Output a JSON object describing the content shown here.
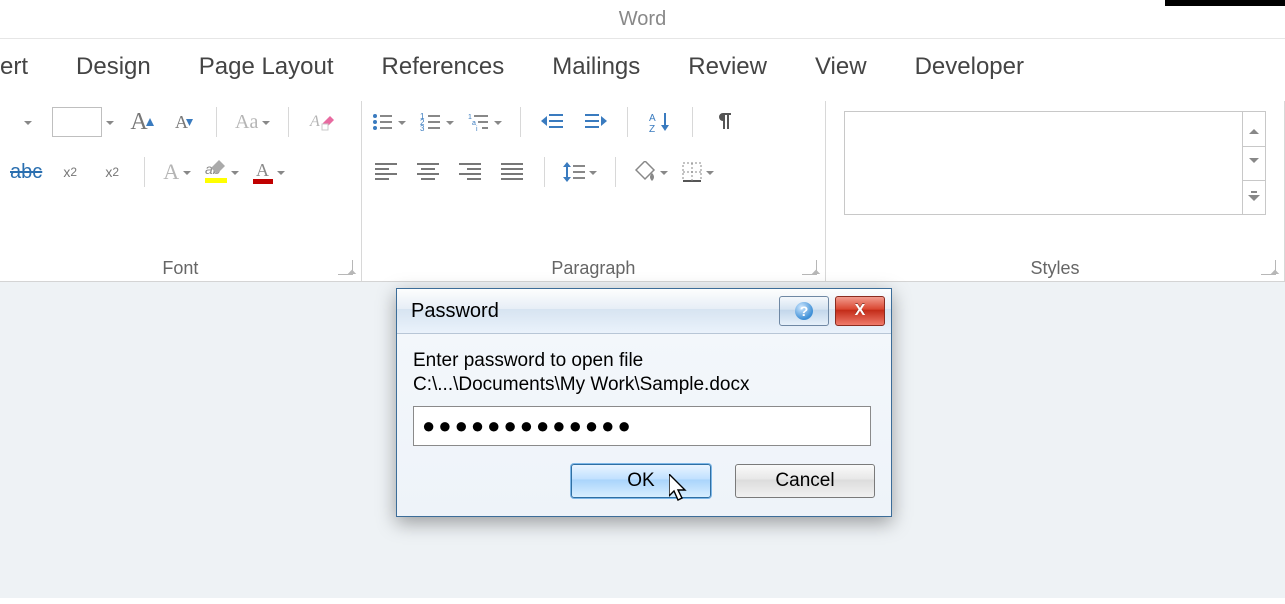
{
  "app": {
    "title": "Word"
  },
  "tabs": {
    "t0": "ert",
    "t1": "Design",
    "t2": "Page Layout",
    "t3": "References",
    "t4": "Mailings",
    "t5": "Review",
    "t6": "View",
    "t7": "Developer"
  },
  "ribbon": {
    "font": {
      "label": "Font",
      "grow": "A",
      "shrink": "A",
      "caseBtn": "Aa",
      "strike": "abc",
      "effects": "A",
      "highlight": "ab",
      "color": "A"
    },
    "paragraph": {
      "label": "Paragraph"
    },
    "styles": {
      "label": "Styles"
    }
  },
  "dialog": {
    "title": "Password",
    "line1": "Enter password to open file",
    "line2": "C:\\...\\Documents\\My Work\\Sample.docx",
    "value": "●●●●●●●●●●●●●",
    "ok": "OK",
    "cancel": "Cancel",
    "help": "?",
    "close": "X"
  }
}
